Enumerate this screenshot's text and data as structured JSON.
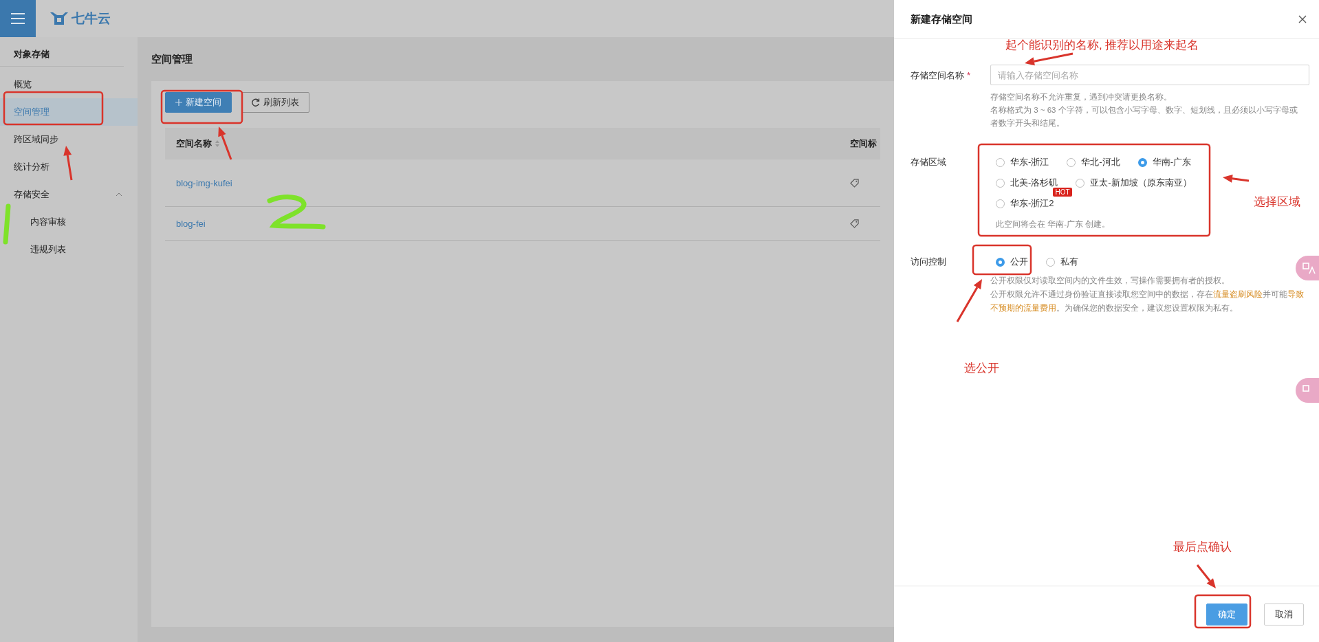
{
  "topbar": {
    "logo_text": "七牛云"
  },
  "sidebar": {
    "title": "对象存储",
    "items": [
      {
        "label": "概览",
        "selected": false
      },
      {
        "label": "空间管理",
        "selected": true
      },
      {
        "label": "跨区域同步",
        "selected": false
      },
      {
        "label": "统计分析",
        "selected": false
      },
      {
        "label": "存储安全",
        "selected": false,
        "expanded": true,
        "children": [
          {
            "label": "内容审核",
            "selected": false
          },
          {
            "label": "违规列表",
            "selected": false
          }
        ]
      }
    ]
  },
  "page": {
    "title": "空间管理",
    "buttons": [
      {
        "label": "新建空间",
        "kind": "primary"
      },
      {
        "label": "刷新列表",
        "kind": "refresh"
      }
    ],
    "table": {
      "columns": [
        "空间名称",
        "空间标"
      ],
      "rows": [
        {
          "name": "blog-img-kufei"
        },
        {
          "name": "blog-fei"
        }
      ]
    }
  },
  "drawer": {
    "title": "新建存储空间",
    "fields": [
      {
        "kind": "text",
        "label": "存储空间名称",
        "required_mark": "*",
        "placeholder": "请输入存储空间名称",
        "hints": [
          "存储空间名称不允许重复，遇到冲突请更换名称。",
          "名称格式为 3 ~ 63 个字符，可以包含小写字母、数字、短划线，且必须以小写字母或者数字开头和结尾。"
        ]
      },
      {
        "kind": "radio",
        "label": "存储区域",
        "options": [
          {
            "label": "华东-浙江",
            "selected": false
          },
          {
            "label": "华北-河北",
            "selected": false
          },
          {
            "label": "华南-广东",
            "selected": true
          },
          {
            "label": "北美-洛杉矶",
            "selected": false
          },
          {
            "label": "亚太-新加坡（原东南亚）",
            "selected": false
          },
          {
            "label": "华东-浙江2",
            "selected": false,
            "badge": "HOT"
          }
        ],
        "note": "此空间将会在 华南-广东 创建。"
      },
      {
        "kind": "radio",
        "label": "访问控制",
        "options": [
          {
            "label": "公开",
            "selected": true
          },
          {
            "label": "私有",
            "selected": false
          }
        ],
        "description": [
          [
            {
              "text": "公开权限仅对读取空间内的文件生效，写操作需要拥有者的授权。",
              "highlight": false
            }
          ],
          [
            {
              "text": "公开权限允许不通过身份验证直接读取您空间中的数据，存在",
              "highlight": false
            },
            {
              "text": "流量盗刷风险",
              "highlight": true
            },
            {
              "text": "并可能",
              "highlight": false
            },
            {
              "text": "导致不预期的流量费用",
              "highlight": true
            },
            {
              "text": "。为确保您的数据安全，建议您设置权限为私有。",
              "highlight": false
            }
          ]
        ]
      }
    ],
    "footer": [
      {
        "label": "确定",
        "kind": "primary"
      },
      {
        "label": "取消",
        "kind": "default"
      }
    ]
  },
  "annotations": [
    {
      "text": "起个能识别的名称, 推荐以用途来起名"
    },
    {
      "text": "选择区域"
    },
    {
      "text": "选公开"
    },
    {
      "text": "最后点确认"
    }
  ]
}
